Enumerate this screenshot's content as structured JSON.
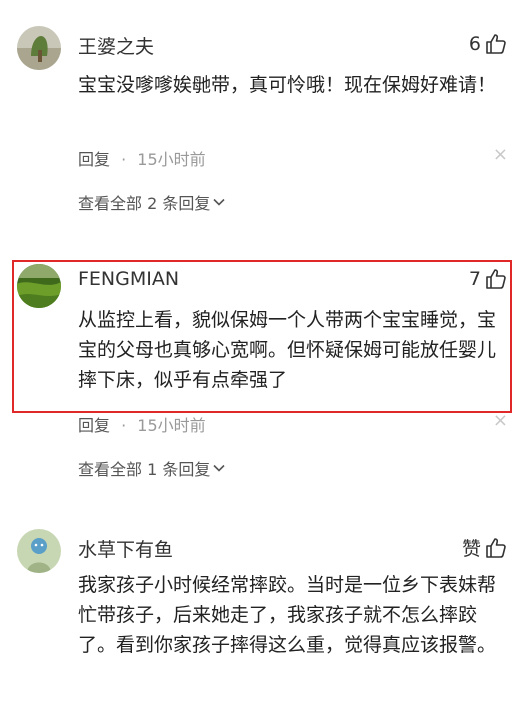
{
  "comments": [
    {
      "author": "王婆之夫",
      "likes": "6",
      "text": "宝宝没嗲嗲娭毑带，真可怜哦！现在保姆好难请！",
      "reply_label": "回复",
      "dot": "·",
      "time": "15小时前",
      "close_glyph": "×",
      "view_replies": "查看全部 2 条回复"
    },
    {
      "author": "FENGMIAN",
      "likes": "7",
      "text": "从监控上看，貌似保姆一个人带两个宝宝睡觉，宝宝的父母也真够心宽啊。但怀疑保姆可能放任婴儿摔下床，似乎有点牵强了",
      "reply_label": "回复",
      "dot": "·",
      "time": "15小时前",
      "close_glyph": "×",
      "view_replies": "查看全部 1 条回复"
    },
    {
      "author": "水草下有鱼",
      "likes": "赞",
      "text": "我家孩子小时候经常摔跤。当时是一位乡下表妹帮忙带孩子，后来她走了，我家孩子就不怎么摔跤了。看到你家孩子摔得这么重，觉得真应该报警。"
    }
  ],
  "colors": {
    "highlight_border": "#e02828",
    "muted_text": "#999999",
    "body_text": "#222222"
  },
  "icons": {
    "like": "thumbs-up-icon",
    "close": "close-icon",
    "expand": "chevron-down-icon"
  }
}
